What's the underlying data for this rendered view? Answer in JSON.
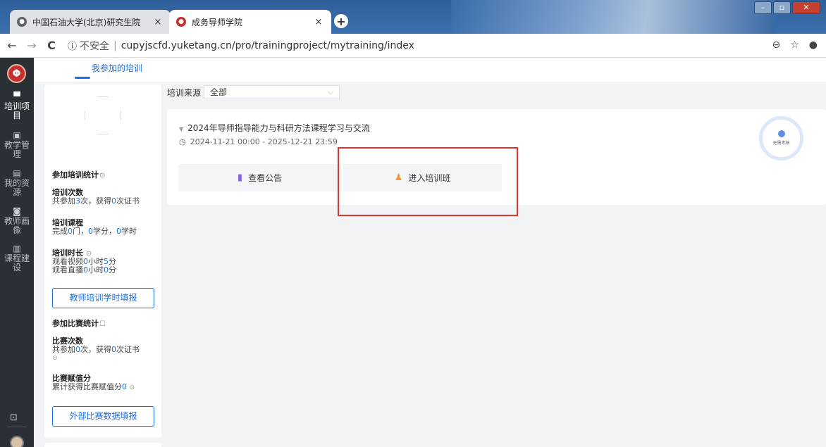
{
  "browser": {
    "tabs": [
      {
        "label": "中国石油大学(北京)研究生院",
        "close": "×"
      },
      {
        "label": "成务导师学院",
        "close": "×"
      }
    ],
    "new_tab": "+",
    "window_controls": {
      "min": "–",
      "max": "▫",
      "close": "✕"
    },
    "nav": {
      "back": "←",
      "forward": "→",
      "reload": "C"
    },
    "address": {
      "info": "ⓘ",
      "security_text": "不安全",
      "separator": "|",
      "url": "cupyjscfd.yuketang.cn/pro/trainingproject/mytraining/index"
    },
    "actions": {
      "zoom": "⊖",
      "star": "☆",
      "account": "●"
    }
  },
  "sidebar": {
    "logo": "Φ",
    "items": [
      {
        "icon": "▀",
        "label": "培训项目",
        "active": true
      },
      {
        "icon": "▣",
        "label": "教学管理",
        "active": false
      },
      {
        "icon": "▤",
        "label": "我的资源",
        "active": false
      },
      {
        "icon": "◙",
        "label": "教师画像",
        "active": false
      },
      {
        "icon": "▥",
        "label": "课程建设",
        "active": false
      }
    ],
    "download_icon": "⊡"
  },
  "page_tab": "我参加的培训",
  "stats": {
    "training_title": "参加培训统计",
    "info_icon": "⊙",
    "count": {
      "title": "培训次数",
      "prefix": "共参加",
      "value": "3",
      "mid": "次，获得",
      "cert": "0",
      "suffix": "次证书"
    },
    "course": {
      "title": "培训课程",
      "prefix": "完成",
      "courses": "0",
      "t1": "门，",
      "credits": "0",
      "t2": "学分，",
      "hours": "0",
      "t3": "学时"
    },
    "duration": {
      "title": "培训时长",
      "video_prefix": "观看视频",
      "video_h": "0",
      "video_mid": "小时",
      "video_m": "5",
      "video_suffix": "分",
      "live_prefix": "观看直播",
      "live_h": "0",
      "live_mid": "小时",
      "live_m": "0",
      "live_suffix": "分"
    },
    "fill_button": "教师培训学时填报",
    "contest_title": "参加比赛统计",
    "contest_icon": "☐",
    "contest_count": {
      "title": "比赛次数",
      "prefix": "共参加",
      "value": "0",
      "mid": "次，获得",
      "cert": "0",
      "suffix": "次证书",
      "info": "⊙"
    },
    "contest_score": {
      "title": "比赛赋值分",
      "prefix": "累计获得比赛赋值分",
      "value": "0"
    },
    "contest_button": "外部比赛数据填报"
  },
  "filter": {
    "label": "培训来源",
    "selected": "全部",
    "chevron": "⌵"
  },
  "training": {
    "arrow": "▼",
    "title": "2024年导师指导能力与科研方法课程学习与交流",
    "clock": "◷",
    "time": "2024-11-21 00:00 - 2025-12-21 23:59",
    "notice_icon": "▮",
    "notice_button": "查看公告",
    "enter_icon": "♟",
    "enter_button": "进入培训班",
    "ring_label": "无需考核"
  }
}
